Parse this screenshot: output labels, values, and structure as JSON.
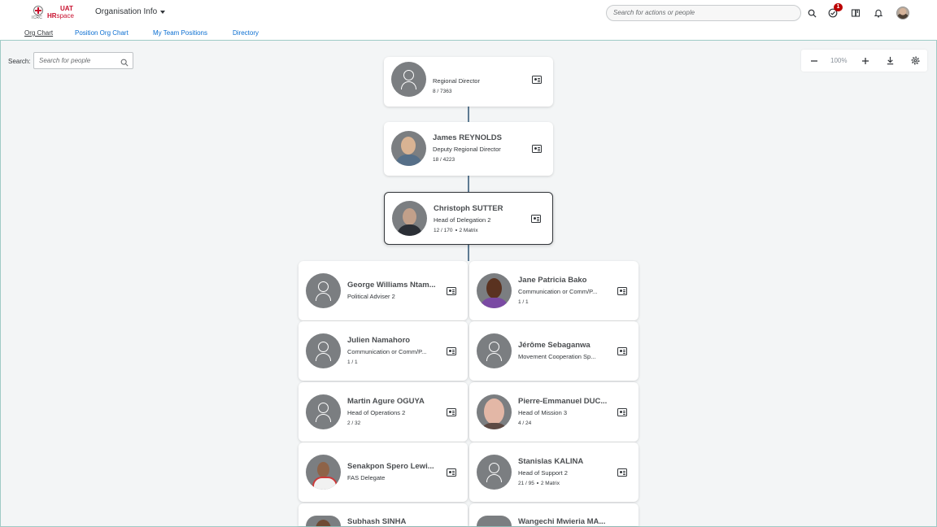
{
  "header": {
    "logo": {
      "emblem": "ICRC",
      "env": "UAT",
      "brand_hr": "HR",
      "brand_space": "space"
    },
    "app_title": "Organisation Info",
    "search_placeholder": "Search for actions or people",
    "notification_count": "1",
    "icons": [
      "search-icon",
      "tasks-icon",
      "book-icon",
      "bell-icon",
      "user-avatar"
    ]
  },
  "tabs": [
    {
      "label": "Org Chart",
      "active": true
    },
    {
      "label": "Position Org Chart",
      "active": false
    },
    {
      "label": "My Team Positions",
      "active": false
    },
    {
      "label": "Directory",
      "active": false
    }
  ],
  "toolbar": {
    "search_label": "Search:",
    "search_placeholder": "Search for people",
    "zoom_level": "100%"
  },
  "chain": [
    {
      "name": "",
      "title": "Regional Director",
      "stats": "8 / 7363",
      "matrix": "",
      "photo": "placeholder"
    },
    {
      "name": "James REYNOLDS",
      "title": "Deputy Regional Director",
      "stats": "18 / 4223",
      "matrix": "",
      "photo": "photo"
    },
    {
      "name": "Christoph SUTTER",
      "title": "Head of Delegation 2",
      "stats": "12 / 170",
      "matrix": "2 Matrix",
      "photo": "photo",
      "selected": true
    }
  ],
  "reports": [
    {
      "name": "George Williams Ntam...",
      "title": "Political Adviser 2",
      "stats": "",
      "matrix": ""
    },
    {
      "name": "Jane Patricia Bako",
      "title": "Communication or Comm/P...",
      "stats": "1 / 1",
      "matrix": ""
    },
    {
      "name": "Julien Namahoro",
      "title": "Communication or Comm/P...",
      "stats": "1 / 1",
      "matrix": ""
    },
    {
      "name": "Jérôme Sebaganwa",
      "title": "Movement Cooperation Sp...",
      "stats": "",
      "matrix": ""
    },
    {
      "name": "Martin Agure OGUYA",
      "title": "Head of Operations 2",
      "stats": "2 / 32",
      "matrix": ""
    },
    {
      "name": "Pierre-Emmanuel DUC...",
      "title": "Head of Mission 3",
      "stats": "4 / 24",
      "matrix": ""
    },
    {
      "name": "Senakpon Spero Lewi...",
      "title": "FAS Delegate",
      "stats": "",
      "matrix": ""
    },
    {
      "name": "Stanislas KALINA",
      "title": "Head of Support 2",
      "stats": "21 / 95",
      "matrix": "2 Matrix"
    },
    {
      "name": "Subhash SINHA",
      "title": "",
      "stats": "",
      "matrix": ""
    },
    {
      "name": "Wangechi Mwieria MA...",
      "title": "",
      "stats": "",
      "matrix": ""
    }
  ]
}
